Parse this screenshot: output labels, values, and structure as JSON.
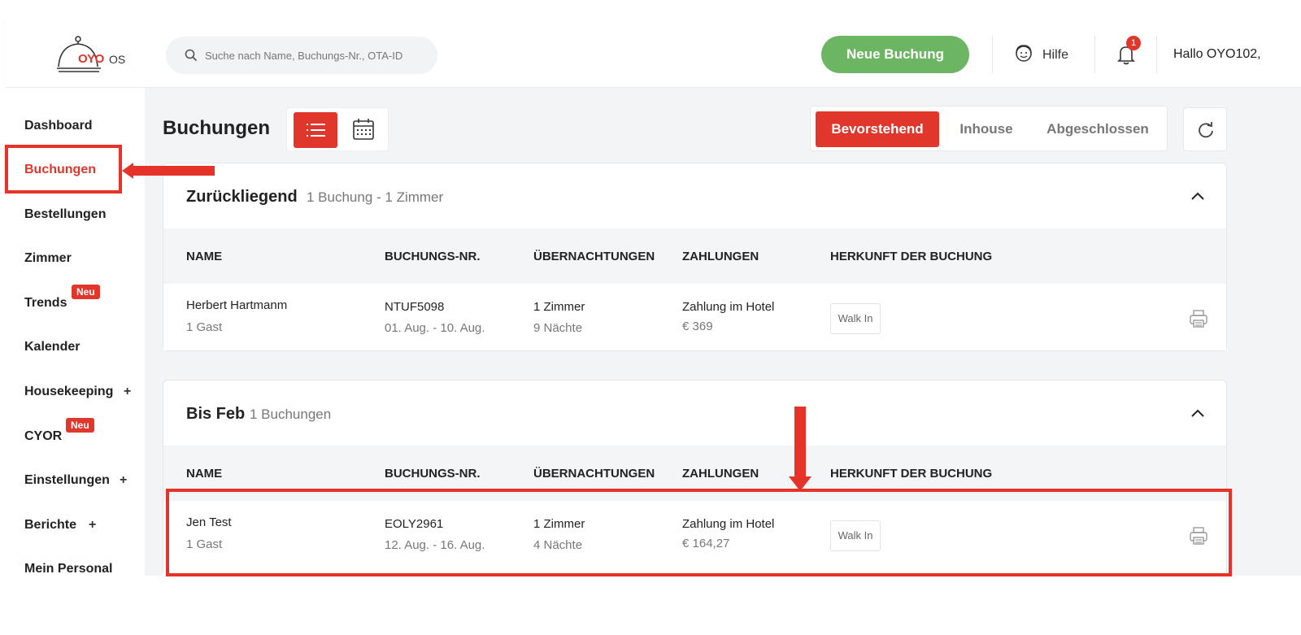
{
  "header": {
    "logo_text": "OYO",
    "logo_suffix": "OS",
    "search_placeholder": "Suche nach Name, Buchungs-Nr., OTA-ID",
    "new_booking_label": "Neue Buchung",
    "help_label": "Hilfe",
    "notification_count": "1",
    "greeting": "Hallo OYO102,"
  },
  "sidebar": {
    "items": [
      {
        "label": "Dashboard"
      },
      {
        "label": "Buchungen"
      },
      {
        "label": "Bestellungen"
      },
      {
        "label": "Zimmer"
      },
      {
        "label": "Trends",
        "badge": "Neu"
      },
      {
        "label": "Kalender"
      },
      {
        "label": "Housekeeping",
        "expand": "+"
      },
      {
        "label": "CYOR",
        "badge": "Neu"
      },
      {
        "label": "Einstellungen",
        "expand": "+"
      },
      {
        "label": "Berichte",
        "expand": "+"
      },
      {
        "label": "Mein Personal"
      }
    ]
  },
  "main": {
    "title": "Buchungen",
    "tabs": [
      {
        "label": "Bevorstehend"
      },
      {
        "label": "Inhouse"
      },
      {
        "label": "Abgeschlossen"
      }
    ],
    "columns": [
      "NAME",
      "BUCHUNGS-NR.",
      "ÜBERNACHTUNGEN",
      "ZAHLUNGEN",
      "HERKUNFT DER BUCHUNG"
    ],
    "sections": [
      {
        "title": "Zurückliegend",
        "summary": "1 Buchung - 1 Zimmer",
        "row": {
          "name": "Herbert Hartmanm",
          "guests": "1 Gast",
          "booking_no": "NTUF5098",
          "dates": "01. Aug. - 10. Aug.",
          "rooms": "1 Zimmer",
          "nights": "9 Nächte",
          "payment": "Zahlung im Hotel",
          "amount": "€ 369",
          "source": "Walk In"
        }
      },
      {
        "title": "Bis Feb",
        "summary": "1 Buchungen",
        "row": {
          "name": "Jen Test",
          "guests": "1 Gast",
          "booking_no": "EOLY2961",
          "dates": "12. Aug. - 16. Aug.",
          "rooms": "1 Zimmer",
          "nights": "4 Nächte",
          "payment": "Zahlung im Hotel",
          "amount": "€ 164,27",
          "source": "Walk In"
        }
      }
    ]
  },
  "colors": {
    "accent": "#e0362c",
    "primary_button": "#6bb563",
    "annotation": "#e5332a"
  }
}
